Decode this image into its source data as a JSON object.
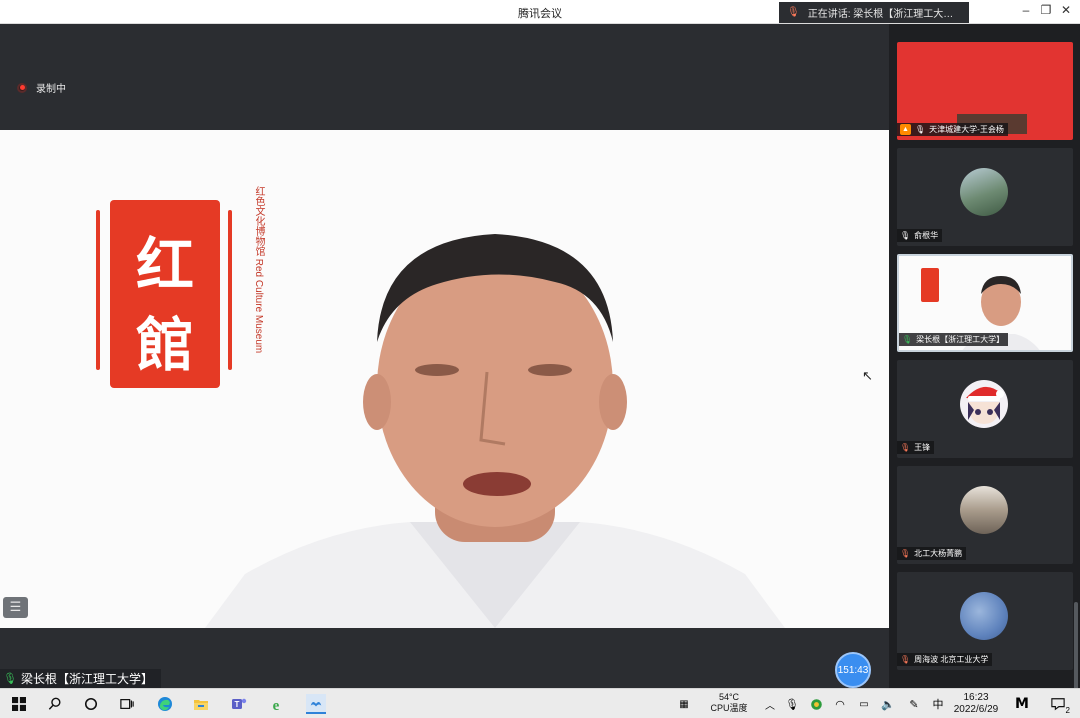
{
  "window": {
    "title": "腾讯会议",
    "speaking_label": "正在讲话: 梁长根【浙江理工大…"
  },
  "recording": {
    "label": "录制中"
  },
  "slide": {
    "seal_char_1": "红",
    "seal_char_2": "館",
    "vertical_text": "红色文化博物馆 Red Culture Museum"
  },
  "speaker": {
    "name": "梁长根【浙江理工大学】"
  },
  "timer": {
    "value": "151:43"
  },
  "participants": [
    {
      "name": "天津城建大学-王会杨"
    },
    {
      "name": "俞根华"
    },
    {
      "name": "梁长根【浙江理工大学】"
    },
    {
      "name": "王锋"
    },
    {
      "name": "北工大杨菁鹏"
    },
    {
      "name": "周海波 北京工业大学"
    }
  ],
  "taskbar": {
    "weather_temp": "54°C",
    "weather_label": "CPU温度",
    "ime": "中",
    "time": "16:23",
    "date": "2022/6/29",
    "notification_count": "2"
  },
  "colors": {
    "accent": "#3a8ef0",
    "seal_red": "#e53a25",
    "host_orange": "#ff8a00",
    "talking_green": "#39c05a"
  }
}
